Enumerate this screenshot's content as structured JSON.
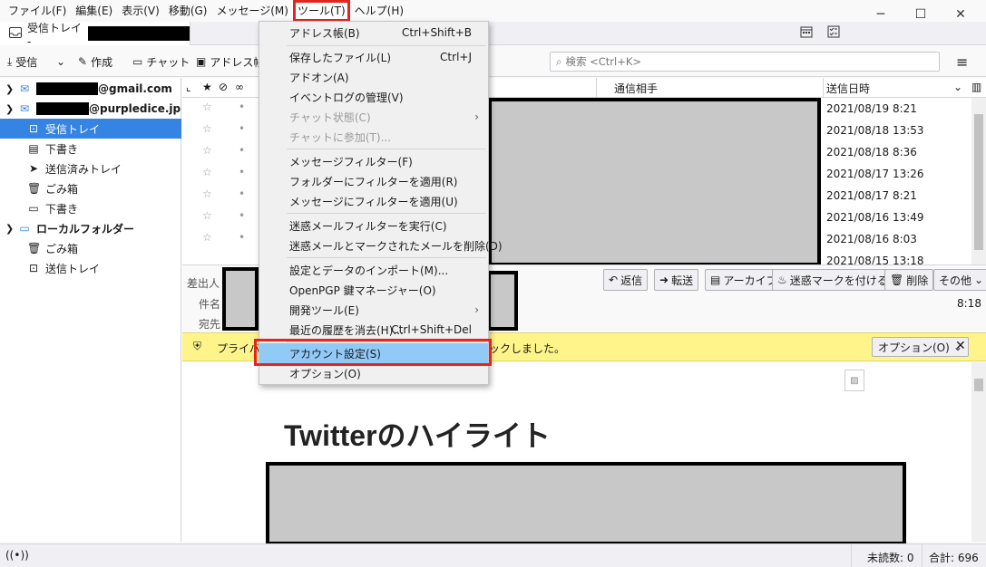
{
  "menubar": {
    "items": [
      "ファイル(F)",
      "編集(E)",
      "表示(V)",
      "移動(G)",
      "メッセージ(M)",
      "ツール(T)",
      "ヘルプ(H)"
    ],
    "window_controls": [
      "─",
      "☐",
      "✕"
    ]
  },
  "tab": {
    "label": "受信トレイ - "
  },
  "toolbar": {
    "get_mail": "受信",
    "write": "作成",
    "chat": "チャット",
    "address_book": "アドレス帳",
    "search_placeholder": "検索 <Ctrl+K>",
    "menu_icon": "≡"
  },
  "folders": {
    "account1_suffix": "@gmail.com",
    "account2_suffix": "@purpledice.jp",
    "items": [
      "受信トレイ",
      "下書き",
      "送信済みトレイ",
      "ごみ箱",
      "下書き"
    ],
    "local": "ローカルフォルダー",
    "local_items": [
      "ごみ箱",
      "送信トレイ"
    ]
  },
  "threads": {
    "col_correspondent": "通信相手",
    "col_date": "送信日時",
    "dates": [
      "2021/08/19 8:21",
      "2021/08/18 13:53",
      "2021/08/18 8:36",
      "2021/08/17 13:26",
      "2021/08/17 8:21",
      "2021/08/16 13:49",
      "2021/08/16 8:03",
      "2021/08/15 13:18"
    ]
  },
  "header": {
    "from_label": "差出人",
    "subject_label": "件名",
    "to_label": "宛先",
    "time": "8:18",
    "buttons": [
      "返信",
      "転送",
      "アーカイブ",
      "迷惑マークを付ける",
      "削除",
      "その他"
    ]
  },
  "notification": {
    "text_left": "プライバシ",
    "text_right": "ックしました。",
    "options": "オプション(O)",
    "close": "✕"
  },
  "message": {
    "headline": "Twitterのハイライト"
  },
  "status": {
    "unread": "未読数: 0",
    "total": "合計: 696"
  },
  "tools_menu": {
    "items": [
      {
        "label": "アドレス帳(B)",
        "shortcut": "Ctrl+Shift+B"
      },
      {
        "label": "保存したファイル(L)",
        "shortcut": "Ctrl+J"
      },
      {
        "label": "アドオン(A)",
        "shortcut": ""
      },
      {
        "label": "イベントログの管理(V)",
        "shortcut": ""
      },
      {
        "label": "チャット状態(C)",
        "shortcut": ""
      },
      {
        "label": "チャットに参加(T)...",
        "shortcut": ""
      },
      {
        "label": "メッセージフィルター(F)",
        "shortcut": ""
      },
      {
        "label": "フォルダーにフィルターを適用(R)",
        "shortcut": ""
      },
      {
        "label": "メッセージにフィルターを適用(U)",
        "shortcut": ""
      },
      {
        "label": "迷惑メールフィルターを実行(C)",
        "shortcut": ""
      },
      {
        "label": "迷惑メールとマークされたメールを削除(D)",
        "shortcut": ""
      },
      {
        "label": "設定とデータのインポート(M)...",
        "shortcut": ""
      },
      {
        "label": "OpenPGP 鍵マネージャー(O)",
        "shortcut": ""
      },
      {
        "label": "開発ツール(E)",
        "shortcut": ""
      },
      {
        "label": "最近の履歴を消去(H)...",
        "shortcut": "Ctrl+Shift+Del"
      },
      {
        "label": "アカウント設定(S)",
        "shortcut": ""
      },
      {
        "label": "オプション(O)",
        "shortcut": ""
      }
    ]
  }
}
